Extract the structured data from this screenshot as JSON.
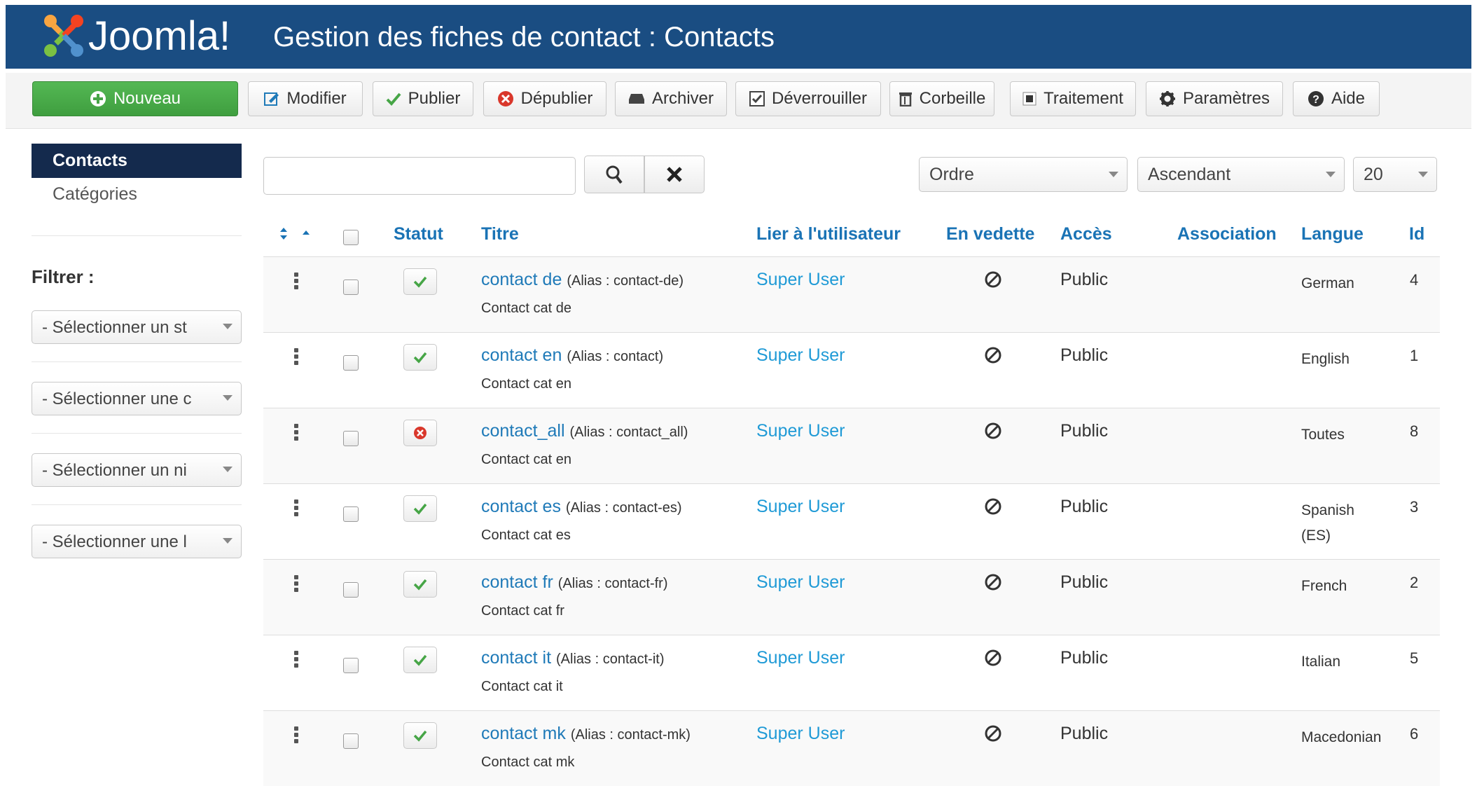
{
  "app": {
    "logo_text": "Joomla!",
    "page_title": "Gestion des fiches de contact : Contacts"
  },
  "toolbar": {
    "new": "Nouveau",
    "edit": "Modifier",
    "publish": "Publier",
    "unpublish": "Dépublier",
    "archive": "Archiver",
    "unlock": "Déverrouiller",
    "trash": "Corbeille",
    "batch": "Traitement",
    "options": "Paramètres",
    "help": "Aide"
  },
  "sidebar": {
    "active": "Contacts",
    "categories": "Catégories",
    "filter_label": "Filtrer :",
    "filters": [
      "- Sélectionner un st",
      "- Sélectionner une c",
      "- Sélectionner un ni",
      "- Sélectionner une l"
    ]
  },
  "search": {
    "placeholder": ""
  },
  "sorting": {
    "order": "Ordre",
    "direction": "Ascendant",
    "limit": "20"
  },
  "table": {
    "headers": {
      "status": "Statut",
      "title": "Titre",
      "user": "Lier à l'utilisateur",
      "featured": "En vedette",
      "access": "Accès",
      "association": "Association",
      "language": "Langue",
      "id": "Id"
    },
    "rows": [
      {
        "title": "contact de",
        "alias": "(Alias : contact-de)",
        "category": "Contact cat de",
        "user": "Super User",
        "access": "Public",
        "language": "German",
        "id": "4",
        "published": true
      },
      {
        "title": "contact en",
        "alias": "(Alias : contact)",
        "category": "Contact cat en",
        "user": "Super User",
        "access": "Public",
        "language": "English",
        "id": "1",
        "published": true
      },
      {
        "title": "contact_all",
        "alias": "(Alias : contact_all)",
        "category": "Contact cat en",
        "user": "Super User",
        "access": "Public",
        "language": "Toutes",
        "id": "8",
        "published": false
      },
      {
        "title": "contact es",
        "alias": "(Alias : contact-es)",
        "category": "Contact cat es",
        "user": "Super User",
        "access": "Public",
        "language": "Spanish (ES)",
        "id": "3",
        "published": true
      },
      {
        "title": "contact fr",
        "alias": "(Alias : contact-fr)",
        "category": "Contact cat fr",
        "user": "Super User",
        "access": "Public",
        "language": "French",
        "id": "2",
        "published": true
      },
      {
        "title": "contact it",
        "alias": "(Alias : contact-it)",
        "category": "Contact cat it",
        "user": "Super User",
        "access": "Public",
        "language": "Italian",
        "id": "5",
        "published": true
      },
      {
        "title": "contact mk",
        "alias": "(Alias : contact-mk)",
        "category": "Contact cat mk",
        "user": "Super User",
        "access": "Public",
        "language": "Macedonian",
        "id": "6",
        "published": true
      }
    ]
  },
  "colors": {
    "header": "#1a4d82",
    "link": "#1f7ab8",
    "user_link": "#1f9ad6",
    "new_button": "#46a546",
    "sidebar_active": "#142a4d"
  }
}
